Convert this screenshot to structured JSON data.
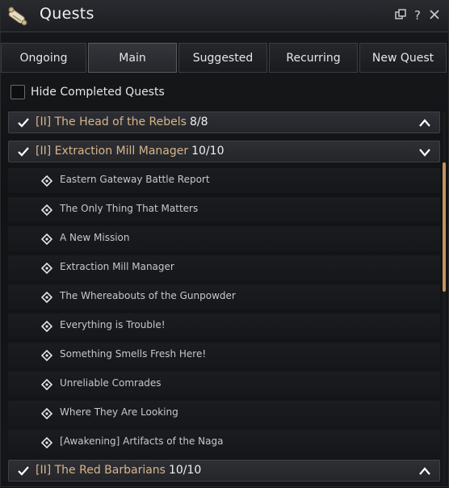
{
  "window": {
    "title": "Quests",
    "icons": [
      "scroll-icon",
      "popout-icon",
      "help-icon",
      "close-icon"
    ],
    "help_label": "?"
  },
  "tabs": [
    {
      "label": "Ongoing",
      "active": false
    },
    {
      "label": "Main",
      "active": true
    },
    {
      "label": "Suggested",
      "active": false
    },
    {
      "label": "Recurring",
      "active": false
    },
    {
      "label": "New Quest",
      "active": false
    }
  ],
  "filter": {
    "hide_completed_label": "Hide Completed Quests",
    "hide_completed_checked": false
  },
  "groups": [
    {
      "title": "[II] The Head of the Rebels",
      "count": "8/8",
      "completed": true,
      "expanded": false,
      "quests": []
    },
    {
      "title": "[II] Extraction Mill Manager",
      "count": "10/10",
      "completed": true,
      "expanded": true,
      "quests": [
        "Eastern Gateway Battle Report",
        "The Only Thing That Matters",
        "A New Mission",
        "Extraction Mill Manager",
        "The Whereabouts of the Gunpowder",
        "Everything is Trouble!",
        "Something Smells Fresh Here!",
        "Unreliable Comrades",
        "Where They Are Looking",
        "[Awakening] Artifacts of the Naga"
      ]
    },
    {
      "title": "[II] The Red Barbarians",
      "count": "10/10",
      "completed": true,
      "expanded": false,
      "quests": []
    }
  ],
  "colors": {
    "group_title": "#d9b48a",
    "scroll_thumb": "#c4935f",
    "background": "#101113"
  }
}
